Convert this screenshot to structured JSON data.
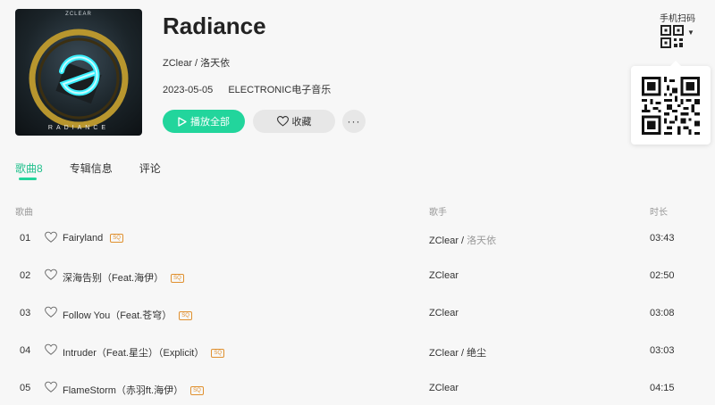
{
  "album": {
    "cover_brand": "ZCLEAR",
    "cover_title": "RADIANCE",
    "title": "Radiance",
    "artists": "ZClear / 洛天依",
    "date": "2023-05-05",
    "genre": "ELECTRONIC电子音乐"
  },
  "actions": {
    "play_all": "播放全部",
    "favorite": "收藏",
    "more": "···"
  },
  "qr": {
    "label": "手机扫码",
    "caret": "▼"
  },
  "tabs": [
    {
      "label": "歌曲8",
      "active": true
    },
    {
      "label": "专辑信息",
      "active": false
    },
    {
      "label": "评论",
      "active": false
    }
  ],
  "columns": {
    "song": "歌曲",
    "artist": "歌手",
    "duration": "时长"
  },
  "tracks": [
    {
      "num": "01",
      "title": "Fairyland",
      "badge": "SQ",
      "artist": "ZClear / ",
      "artist_secondary": "洛天依",
      "duration": "03:43"
    },
    {
      "num": "02",
      "title": "深海告别（Feat.海伊）",
      "badge": "SQ",
      "artist": "ZClear",
      "artist_secondary": "",
      "duration": "02:50"
    },
    {
      "num": "03",
      "title": "Follow You（Feat.苍穹）",
      "badge": "SQ",
      "artist": "ZClear",
      "artist_secondary": "",
      "duration": "03:08"
    },
    {
      "num": "04",
      "title": "Intruder（Feat.星尘）（Explicit）",
      "badge": "SQ",
      "artist": "ZClear / 绝尘",
      "artist_secondary": "",
      "duration": "03:03"
    },
    {
      "num": "05",
      "title": "FlameStorm（赤羽ft.海伊）",
      "badge": "SQ",
      "artist": "ZClear",
      "artist_secondary": "",
      "duration": "04:15"
    }
  ],
  "colors": {
    "accent": "#22d59c",
    "badge": "#e0902f",
    "muted": "#999999"
  }
}
